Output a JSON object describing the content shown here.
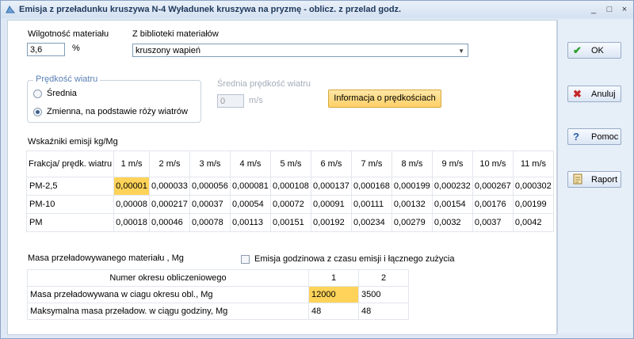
{
  "window": {
    "title": "Emisja z przeładunku kruszywa  N-4  Wyładunek kruszywa na pryzmę - oblicz. z przelad godz.",
    "controls": [
      "_",
      "□",
      "×"
    ]
  },
  "moisture": {
    "label": "Wilgotność materiału",
    "value": "3,6",
    "unit": "%"
  },
  "library": {
    "label": "Z biblioteki materiałów",
    "value": "kruszony wapień"
  },
  "wind": {
    "group_label": "Prędkość wiatru",
    "option_avg": "Średnia",
    "option_variable": "Zmienna, na podstawie róży wiatrów",
    "avg_speed_label": "Średnia prędkość wiatru",
    "avg_speed_value": "0",
    "avg_speed_unit": "m/s",
    "info_button": "Informacja o prędkościach"
  },
  "emission": {
    "title": "Wskaźniki emisji  kg/Mg",
    "corner_header": "Frakcja/ prędk. wiatru",
    "columns": [
      "1 m/s",
      "2 m/s",
      "3 m/s",
      "4 m/s",
      "5 m/s",
      "6 m/s",
      "7 m/s",
      "8 m/s",
      "9 m/s",
      "10 m/s",
      "11 m/s"
    ],
    "rows": [
      {
        "name": "PM-2,5",
        "values": [
          "0,00001",
          "0,000033",
          "0,000056",
          "0,000081",
          "0,000108",
          "0,000137",
          "0,000168",
          "0,000199",
          "0,000232",
          "0,000267",
          "0,000302"
        ]
      },
      {
        "name": "PM-10",
        "values": [
          "0,00008",
          "0,000217",
          "0,00037",
          "0,00054",
          "0,00072",
          "0,00091",
          "0,00111",
          "0,00132",
          "0,00154",
          "0,00176",
          "0,00199"
        ]
      },
      {
        "name": "PM",
        "values": [
          "0,00018",
          "0,00046",
          "0,00078",
          "0,00113",
          "0,00151",
          "0,00192",
          "0,00234",
          "0,00279",
          "0,0032",
          "0,0037",
          "0,0042"
        ]
      }
    ]
  },
  "mass": {
    "title": "Masa przeładowywanego materiału , Mg",
    "hourly_checkbox_label": "Emisja godzinowa z czasu emisji i łącznego zużycia",
    "header_label": "Numer okresu obliczeniowego",
    "periods": [
      "1",
      "2"
    ],
    "row1_label": "Masa przeładowywana w ciagu okresu obl., Mg",
    "row1_values": [
      "12000",
      "3500"
    ],
    "row2_label": "Maksymalna masa przeładow. w ciągu godziny, Mg",
    "row2_values": [
      "48",
      "48"
    ]
  },
  "buttons": {
    "ok": "OK",
    "cancel": "Anuluj",
    "help": "Pomoc",
    "report": "Raport"
  },
  "colors": {
    "selection": "#ffd359",
    "info_button": "#ffd067",
    "ok_icon": "#2e9e2e",
    "cancel_icon": "#c62828",
    "help_icon": "#2a5caa"
  }
}
